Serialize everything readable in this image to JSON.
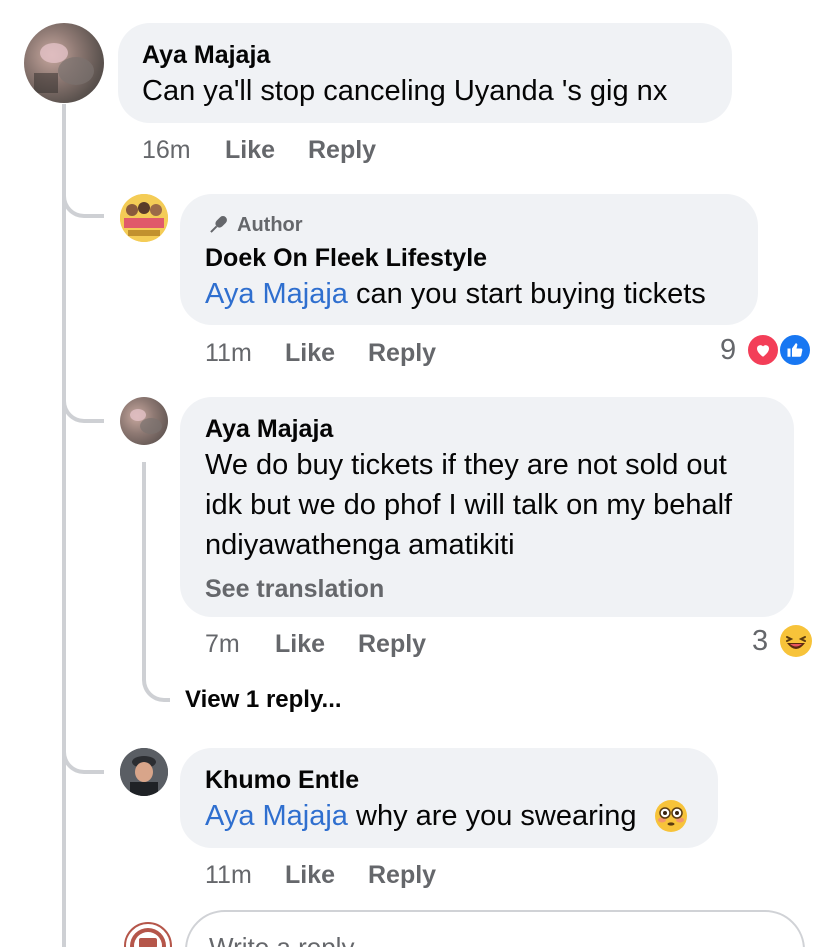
{
  "comment": {
    "author": "Aya Majaja",
    "text": "Can ya'll  stop canceling Uyanda 's gig nx",
    "time": "16m",
    "like": "Like",
    "reply": "Reply"
  },
  "replies": [
    {
      "badge": "Author",
      "author": "Doek On Fleek Lifestyle",
      "mention": "Aya Majaja",
      "text": " can you start buying tickets",
      "time": "11m",
      "like": "Like",
      "reply": "Reply",
      "reaction_count": "9",
      "reaction_icons": [
        "heart-icon",
        "thumbs-up-icon"
      ]
    },
    {
      "author": "Aya Majaja",
      "text_lines": [
        "We do buy tickets if they are not sold out",
        "idk but we do phof I will talk on my behalf",
        "ndiyawathenga amatikiti"
      ],
      "see_translation": "See translation",
      "time": "7m",
      "like": "Like",
      "reply": "Reply",
      "reaction_count": "3",
      "reaction_icons": [
        "laughing-emoji-icon"
      ],
      "view_replies": "View 1 reply..."
    },
    {
      "author": "Khumo Entle",
      "mention": "Aya Majaja",
      "text": " why are you swearing",
      "emoji": "flushed-emoji-icon",
      "time": "11m",
      "like": "Like",
      "reply": "Reply"
    }
  ],
  "composer": {
    "placeholder": "Write a reply..."
  },
  "colors": {
    "bubble": "#f0f2f5",
    "mention": "#2f6fcf",
    "meta": "#65676b",
    "thread_line": "#ced0d4"
  }
}
